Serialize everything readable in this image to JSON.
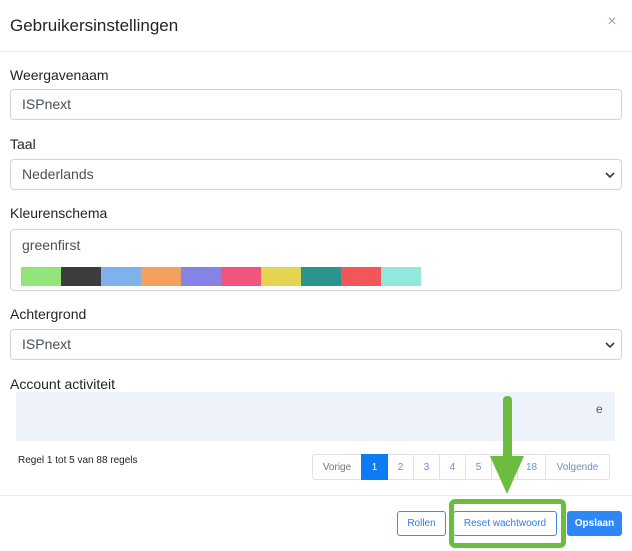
{
  "modal": {
    "title": "Gebruikersinstellingen",
    "close_symbol": "×"
  },
  "fields": {
    "display_name": {
      "label": "Weergavenaam",
      "value": "ISPnext"
    },
    "language": {
      "label": "Taal",
      "value": "Nederlands"
    },
    "color_scheme": {
      "label": "Kleurenschema",
      "value": "greenfirst",
      "swatches": [
        "#92e57a",
        "#3c3c3f",
        "#7fb2ec",
        "#f4a15f",
        "#8583e6",
        "#f1547f",
        "#e4d452",
        "#2b948e",
        "#f2565b",
        "#93e8dd"
      ]
    },
    "background": {
      "label": "Achtergrond",
      "value": "ISPnext"
    }
  },
  "activity": {
    "label": "Account activiteit",
    "overflow_glyph": "e",
    "info": "Regel 1 tot 5 van 88 regels",
    "pagination": {
      "previous": "Vorige",
      "pages": [
        "1",
        "2",
        "3",
        "4",
        "5",
        "",
        "18"
      ],
      "next": "Volgende"
    }
  },
  "footer": {
    "roles_label": "Rollen",
    "reset_password_label": "Reset wachtwoord",
    "save_label": "Opslaan"
  },
  "colors": {
    "primary": "#2f86f5",
    "annotation_green": "#6abd3f"
  }
}
